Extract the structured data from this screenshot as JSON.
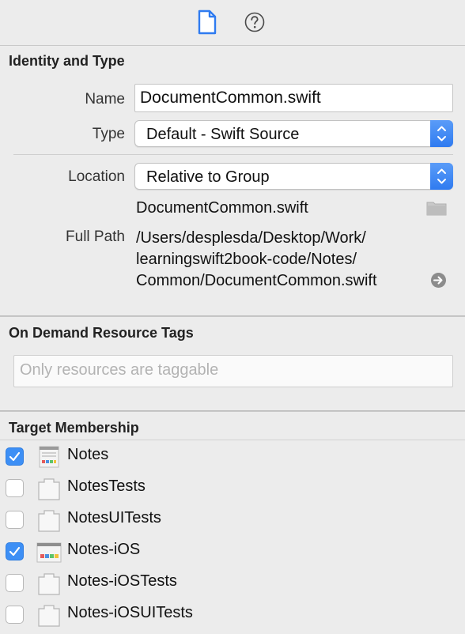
{
  "toolbar": {
    "file_inspector_icon": "document-icon",
    "help_icon": "question-mark-icon",
    "accent_color": "#2f7bf0"
  },
  "identity": {
    "title": "Identity and Type",
    "name_label": "Name",
    "name_value": "DocumentCommon.swift",
    "type_label": "Type",
    "type_value": "Default - Swift Source",
    "location_label": "Location",
    "location_value": "Relative to Group",
    "file_name": "DocumentCommon.swift",
    "full_path_label": "Full Path",
    "full_path_lines": [
      "/Users/desplesda/Desktop/Work/",
      "learningswift2book-code/Notes/",
      "Common/DocumentCommon.swift"
    ]
  },
  "on_demand": {
    "title": "On Demand Resource Tags",
    "placeholder": "Only resources are taggable"
  },
  "targets": {
    "title": "Target Membership",
    "items": [
      {
        "label": "Notes",
        "checked": true,
        "icon": "app-icon"
      },
      {
        "label": "NotesTests",
        "checked": false,
        "icon": "test-bundle-icon"
      },
      {
        "label": "NotesUITests",
        "checked": false,
        "icon": "test-bundle-icon"
      },
      {
        "label": "Notes-iOS",
        "checked": true,
        "icon": "ios-app-icon"
      },
      {
        "label": "Notes-iOSTests",
        "checked": false,
        "icon": "test-bundle-icon"
      },
      {
        "label": "Notes-iOSUITests",
        "checked": false,
        "icon": "test-bundle-icon"
      }
    ]
  }
}
